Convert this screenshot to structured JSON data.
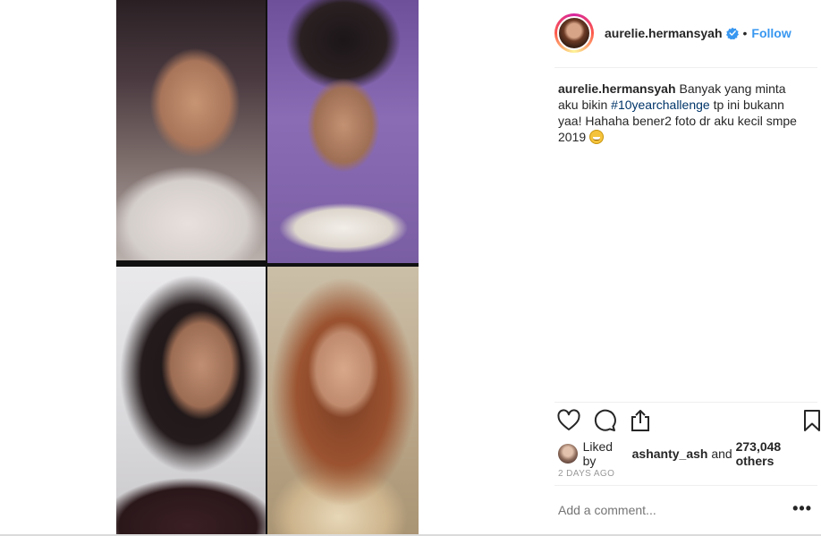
{
  "post": {
    "username": "aurelie.hermansyah",
    "separator": "•",
    "follow_label": "Follow",
    "caption_username": "aurelie.hermansyah",
    "caption_part1": "Banyak yang minta aku bikin ",
    "hashtag": "#10yearchallenge",
    "caption_part2": " tp ini bukann yaa! Hahaha bener2 foto dr aku kecil smpe 2019 ",
    "emoji": "grinning-face-emoji",
    "liked_prefix": "Liked by ",
    "liked_user": "ashanty_ash",
    "liked_and": " and ",
    "liked_count": "273,048 others",
    "time": "2 DAYS AGO",
    "comment_placeholder": "Add a comment...",
    "more_label": "•••"
  },
  "icons": {
    "verified": "verified-badge-icon",
    "like": "heart-icon",
    "comment": "comment-icon",
    "share": "share-icon",
    "save": "bookmark-icon"
  },
  "colors": {
    "accent": "#3897f0",
    "hashtag": "#003569",
    "text": "#262626",
    "muted": "#999999"
  }
}
